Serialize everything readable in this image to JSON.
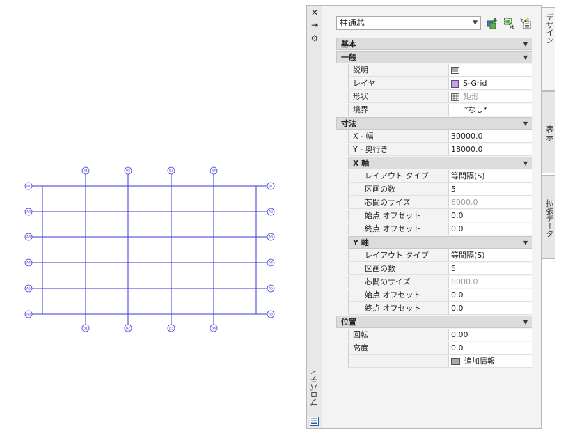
{
  "grid": {
    "top_labels": [
      "B1",
      "B2",
      "B3",
      "B4"
    ],
    "bottom_labels": [
      "B1",
      "B2",
      "B3",
      "B4"
    ],
    "left_labels": [
      "A1",
      "A2",
      "A3",
      "A4",
      "A5",
      "A6"
    ],
    "right_labels": [
      "A1",
      "A2",
      "A3",
      "A4",
      "A5",
      "A6"
    ],
    "line_color": "#3a3ad6"
  },
  "palette": {
    "strip": {
      "close_glyph": "✕",
      "autohide_glyph": "⇥",
      "settings_glyph": "⚙",
      "title": "プロパティ"
    },
    "style_combo": {
      "value": "柱通芯"
    },
    "tabs": [
      {
        "label": "デザイン"
      },
      {
        "label": "表示"
      },
      {
        "label": "拡張データ"
      }
    ],
    "categories": {
      "basic": "基本",
      "general": "一般",
      "dimensions": "寸法",
      "x_axis": "X 軸",
      "y_axis": "Y 軸",
      "location": "位置"
    },
    "general": {
      "description_label": "説明",
      "layer_label": "レイヤ",
      "layer_value": "S-Grid",
      "layer_color": "#c89cf2",
      "shape_label": "形状",
      "shape_value": "矩形",
      "boundary_label": "境界",
      "boundary_value": "*なし*"
    },
    "dimensions": {
      "x_width_label": "X - 幅",
      "x_width_value": "30000.0",
      "y_depth_label": "Y - 奥行き",
      "y_depth_value": "18000.0"
    },
    "x_axis": {
      "layout_type_label": "レイアウト タイプ",
      "layout_type_value": "等間隔(S)",
      "bays_label": "区画の数",
      "bays_value": "5",
      "bay_size_label": "芯間のサイズ",
      "bay_size_value": "6000.0",
      "start_offset_label": "始点 オフセット",
      "start_offset_value": "0.0",
      "end_offset_label": "終点 オフセット",
      "end_offset_value": "0.0"
    },
    "y_axis": {
      "layout_type_label": "レイアウト タイプ",
      "layout_type_value": "等間隔(S)",
      "bays_label": "区画の数",
      "bays_value": "5",
      "bay_size_label": "芯間のサイズ",
      "bay_size_value": "6000.0",
      "start_offset_label": "始点 オフセット",
      "start_offset_value": "0.0",
      "end_offset_label": "終点 オフセット",
      "end_offset_value": "0.0"
    },
    "location": {
      "rotation_label": "回転",
      "rotation_value": "0.00",
      "elevation_label": "高度",
      "elevation_value": "0.0",
      "additional_info_value": "追加情報"
    },
    "collapse_glyph": "▼",
    "dropdown_glyph": "▼"
  }
}
